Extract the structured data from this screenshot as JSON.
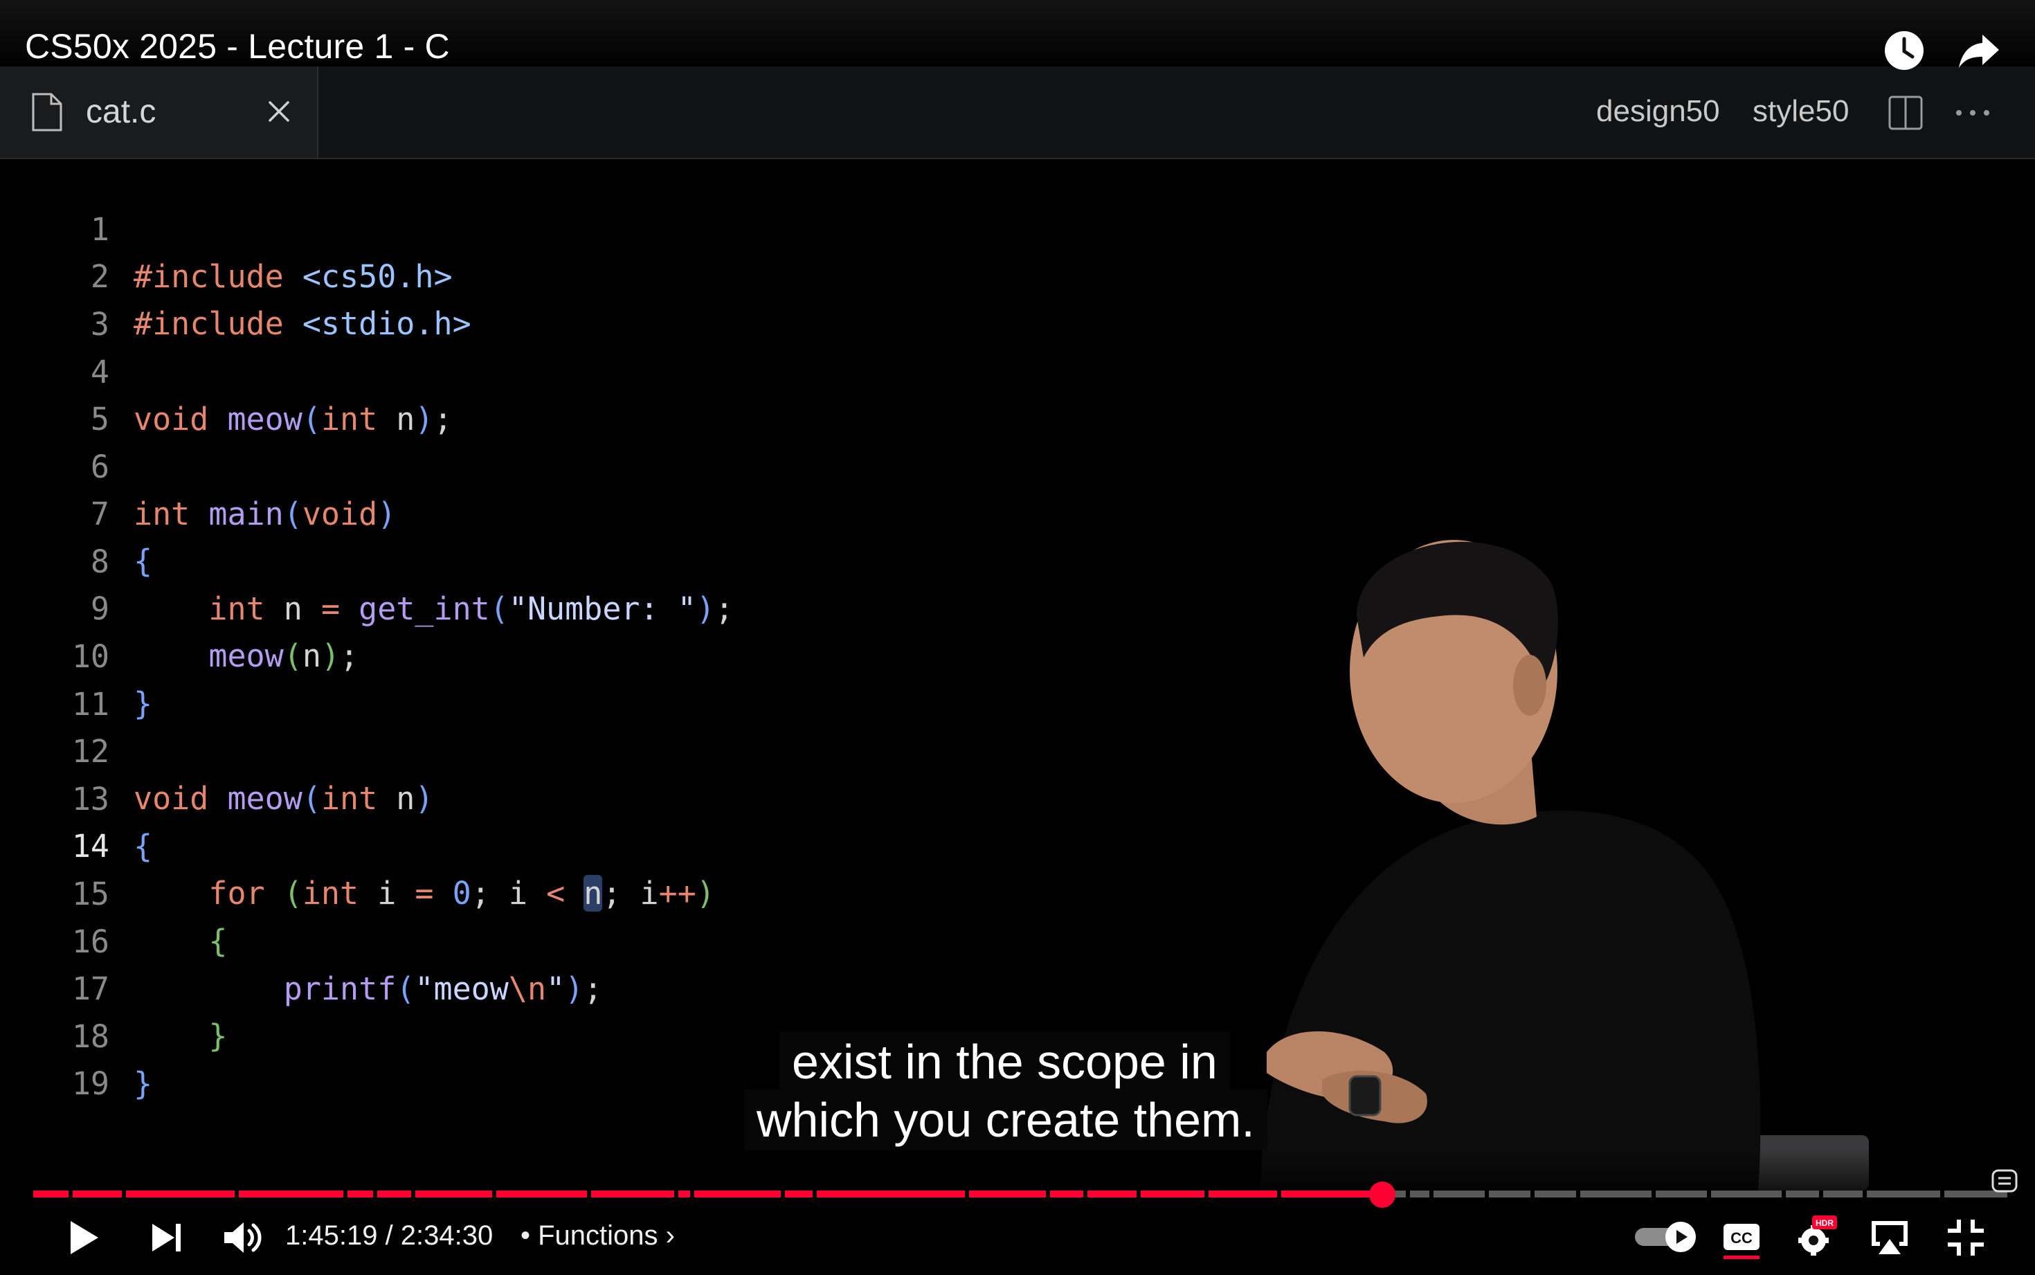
{
  "video": {
    "title": "CS50x 2025 - Lecture 1 - C"
  },
  "editor": {
    "file_tab_label": "cat.c",
    "design50_label": "design50",
    "style50_label": "style50"
  },
  "code": {
    "line_numbers": [
      "1",
      "2",
      "3",
      "4",
      "5",
      "6",
      "7",
      "8",
      "9",
      "10",
      "11",
      "12",
      "13",
      "14",
      "15",
      "16",
      "17",
      "18",
      "19"
    ],
    "active_line": "14"
  },
  "captions": {
    "line1": "exist in the scope in",
    "line2": "which you create them."
  },
  "player": {
    "time_display": "1:45:19 / 2:34:30",
    "chapter_label": "• Functions ›",
    "progress_fraction": 0.682,
    "accent_color": "#ff0033",
    "captions_badge": "CC",
    "hdr_badge": "HDR"
  }
}
